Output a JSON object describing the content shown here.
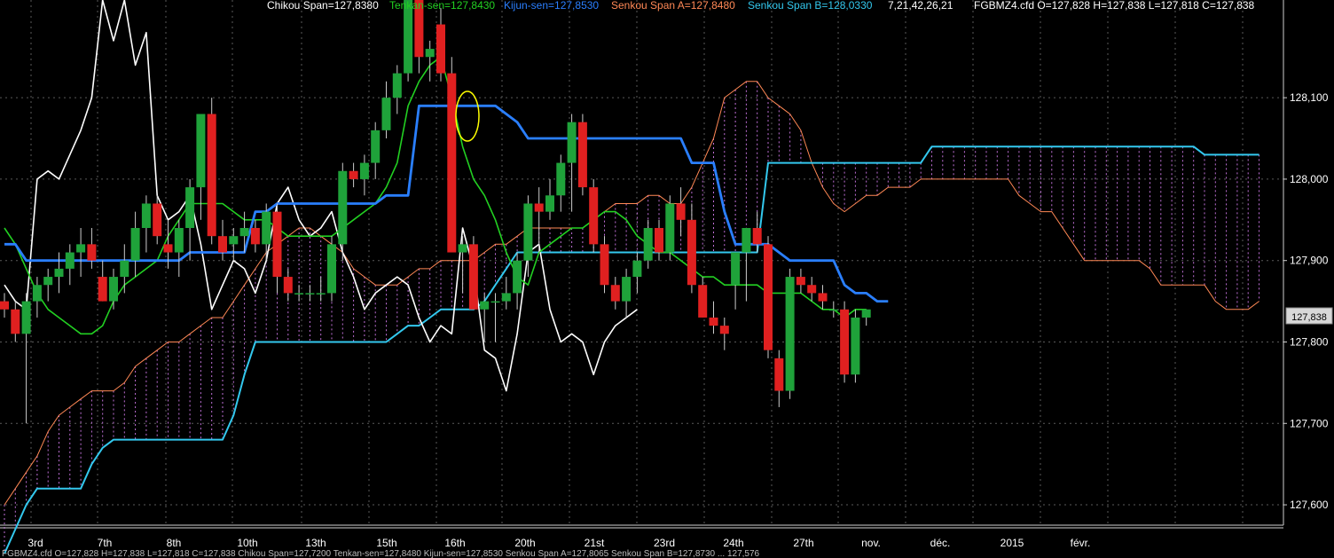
{
  "legend": {
    "chikou": "Chikou Span=127,8380",
    "tenkan": "Tenkan-sen=127,8430",
    "kijun": "Kijun-sen=127,8530",
    "senkou_a": "Senkou Span A=127,8480",
    "senkou_b": "Senkou Span B=128,0330",
    "params": "7,21,42,26,21",
    "ohlc": "FGBMZ4.cfd O=127,828 H=127,838 L=127,818 C=127,838"
  },
  "last_price_label": "127,838",
  "status_bar": "FGBMZ4.cfd O=127,828 H=127,838 L=127,818 C=127,838  Chikou Span=127,7200 Tenkan-sen=127,8480 Kijun-sen=127,8530 Senkou Span A=127,8065 Senkou Span B=127,8730 ... 127,576",
  "colors": {
    "background": "#000000",
    "grid": "#5a5a5a",
    "candle_up": "#1fa23a",
    "candle_down": "#e02020",
    "chikou": "#ffffff",
    "tenkan": "#22d022",
    "kijun": "#2a7fff",
    "senkou_a": "#ff8855",
    "senkou_b": "#33c8ee",
    "cloud": "#c070d8",
    "highlight": "#ffff00"
  },
  "chart_data": {
    "type": "candlestick",
    "instrument": "FGBMZ4.cfd",
    "ylim": [
      127.575,
      128.22
    ],
    "y_ticks": [
      "127,600",
      "127,700",
      "127,800",
      "127,900",
      "128,000",
      "128,100"
    ],
    "y_tick_values": [
      127.6,
      127.7,
      127.8,
      127.9,
      128.0,
      128.1
    ],
    "x_tick_labels": [
      "3rd",
      "7th",
      "8th",
      "10th",
      "13th",
      "15th",
      "16th",
      "20th",
      "21st",
      "23rd",
      "24th",
      "27th",
      "nov.",
      "déc.",
      "2015",
      "févr."
    ],
    "candles": [
      {
        "o": 127.85,
        "h": 127.86,
        "l": 127.83,
        "c": 127.84
      },
      {
        "o": 127.84,
        "h": 127.85,
        "l": 127.8,
        "c": 127.81
      },
      {
        "o": 127.81,
        "h": 127.86,
        "l": 127.7,
        "c": 127.85
      },
      {
        "o": 127.85,
        "h": 127.88,
        "l": 127.83,
        "c": 127.87
      },
      {
        "o": 127.87,
        "h": 127.89,
        "l": 127.85,
        "c": 127.88
      },
      {
        "o": 127.88,
        "h": 127.91,
        "l": 127.86,
        "c": 127.89
      },
      {
        "o": 127.89,
        "h": 127.92,
        "l": 127.87,
        "c": 127.91
      },
      {
        "o": 127.91,
        "h": 127.94,
        "l": 127.88,
        "c": 127.92
      },
      {
        "o": 127.92,
        "h": 127.94,
        "l": 127.89,
        "c": 127.9
      },
      {
        "o": 127.88,
        "h": 127.9,
        "l": 127.85,
        "c": 127.85
      },
      {
        "o": 127.85,
        "h": 127.89,
        "l": 127.84,
        "c": 127.88
      },
      {
        "o": 127.88,
        "h": 127.92,
        "l": 127.86,
        "c": 127.9
      },
      {
        "o": 127.9,
        "h": 127.96,
        "l": 127.88,
        "c": 127.94
      },
      {
        "o": 127.94,
        "h": 127.98,
        "l": 127.91,
        "c": 127.97
      },
      {
        "o": 127.97,
        "h": 127.98,
        "l": 127.92,
        "c": 127.93
      },
      {
        "o": 127.92,
        "h": 127.95,
        "l": 127.89,
        "c": 127.91
      },
      {
        "o": 127.91,
        "h": 127.95,
        "l": 127.88,
        "c": 127.94
      },
      {
        "o": 127.94,
        "h": 128.0,
        "l": 127.9,
        "c": 127.99
      },
      {
        "o": 127.99,
        "h": 128.08,
        "l": 127.95,
        "c": 128.08
      },
      {
        "o": 128.08,
        "h": 128.1,
        "l": 127.92,
        "c": 127.93
      },
      {
        "o": 127.93,
        "h": 127.95,
        "l": 127.9,
        "c": 127.91
      },
      {
        "o": 127.92,
        "h": 127.94,
        "l": 127.9,
        "c": 127.93
      },
      {
        "o": 127.93,
        "h": 127.96,
        "l": 127.91,
        "c": 127.94
      },
      {
        "o": 127.94,
        "h": 127.95,
        "l": 127.91,
        "c": 127.92
      },
      {
        "o": 127.92,
        "h": 127.97,
        "l": 127.9,
        "c": 127.96
      },
      {
        "o": 127.96,
        "h": 127.97,
        "l": 127.86,
        "c": 127.88
      },
      {
        "o": 127.88,
        "h": 127.89,
        "l": 127.85,
        "c": 127.86
      },
      {
        "o": 127.86,
        "h": 127.87,
        "l": 127.85,
        "c": 127.86
      },
      {
        "o": 127.86,
        "h": 127.87,
        "l": 127.85,
        "c": 127.86
      },
      {
        "o": 127.86,
        "h": 127.88,
        "l": 127.85,
        "c": 127.86
      },
      {
        "o": 127.86,
        "h": 127.93,
        "l": 127.85,
        "c": 127.92
      },
      {
        "o": 127.92,
        "h": 128.02,
        "l": 127.9,
        "c": 128.01
      },
      {
        "o": 128.01,
        "h": 128.02,
        "l": 127.99,
        "c": 128.0
      },
      {
        "o": 128.0,
        "h": 128.03,
        "l": 127.98,
        "c": 128.02
      },
      {
        "o": 128.02,
        "h": 128.07,
        "l": 128.0,
        "c": 128.06
      },
      {
        "o": 128.06,
        "h": 128.12,
        "l": 128.05,
        "c": 128.1
      },
      {
        "o": 128.1,
        "h": 128.14,
        "l": 128.08,
        "c": 128.13
      },
      {
        "o": 128.13,
        "h": 128.25,
        "l": 128.12,
        "c": 128.22
      },
      {
        "o": 128.22,
        "h": 128.23,
        "l": 128.13,
        "c": 128.15
      },
      {
        "o": 128.15,
        "h": 128.17,
        "l": 128.12,
        "c": 128.16
      },
      {
        "o": 128.19,
        "h": 128.21,
        "l": 128.12,
        "c": 128.13
      },
      {
        "o": 128.13,
        "h": 128.15,
        "l": 127.91,
        "c": 127.91
      },
      {
        "o": 127.91,
        "h": 127.93,
        "l": 127.86,
        "c": 127.92
      },
      {
        "o": 127.92,
        "h": 127.93,
        "l": 127.84,
        "c": 127.84
      },
      {
        "o": 127.84,
        "h": 127.86,
        "l": 127.8,
        "c": 127.85
      },
      {
        "o": 127.85,
        "h": 127.86,
        "l": 127.8,
        "c": 127.85
      },
      {
        "o": 127.85,
        "h": 127.88,
        "l": 127.84,
        "c": 127.86
      },
      {
        "o": 127.86,
        "h": 127.91,
        "l": 127.84,
        "c": 127.9
      },
      {
        "o": 127.9,
        "h": 127.98,
        "l": 127.88,
        "c": 127.97
      },
      {
        "o": 127.97,
        "h": 127.99,
        "l": 127.91,
        "c": 127.96
      },
      {
        "o": 127.96,
        "h": 128.0,
        "l": 127.95,
        "c": 127.98
      },
      {
        "o": 127.98,
        "h": 128.03,
        "l": 127.96,
        "c": 128.02
      },
      {
        "o": 128.02,
        "h": 128.08,
        "l": 127.96,
        "c": 128.07
      },
      {
        "o": 128.07,
        "h": 128.08,
        "l": 127.98,
        "c": 127.99
      },
      {
        "o": 127.99,
        "h": 128.0,
        "l": 127.91,
        "c": 127.92
      },
      {
        "o": 127.92,
        "h": 127.93,
        "l": 127.86,
        "c": 127.87
      },
      {
        "o": 127.87,
        "h": 127.88,
        "l": 127.84,
        "c": 127.85
      },
      {
        "o": 127.85,
        "h": 127.89,
        "l": 127.83,
        "c": 127.88
      },
      {
        "o": 127.88,
        "h": 127.91,
        "l": 127.86,
        "c": 127.9
      },
      {
        "o": 127.9,
        "h": 127.95,
        "l": 127.89,
        "c": 127.94
      },
      {
        "o": 127.94,
        "h": 127.95,
        "l": 127.9,
        "c": 127.91
      },
      {
        "o": 127.91,
        "h": 127.98,
        "l": 127.9,
        "c": 127.97
      },
      {
        "o": 127.97,
        "h": 127.99,
        "l": 127.93,
        "c": 127.95
      },
      {
        "o": 127.95,
        "h": 127.97,
        "l": 127.86,
        "c": 127.87
      },
      {
        "o": 127.87,
        "h": 127.88,
        "l": 127.83,
        "c": 127.83
      },
      {
        "o": 127.83,
        "h": 127.85,
        "l": 127.81,
        "c": 127.82
      },
      {
        "o": 127.82,
        "h": 127.83,
        "l": 127.79,
        "c": 127.81
      },
      {
        "o": 127.87,
        "h": 127.9,
        "l": 127.84,
        "c": 127.91
      },
      {
        "o": 127.91,
        "h": 127.93,
        "l": 127.85,
        "c": 127.94
      },
      {
        "o": 127.94,
        "h": 127.96,
        "l": 127.91,
        "c": 127.92
      },
      {
        "o": 127.92,
        "h": 127.93,
        "l": 127.78,
        "c": 127.79
      },
      {
        "o": 127.78,
        "h": 127.79,
        "l": 127.72,
        "c": 127.74
      },
      {
        "o": 127.74,
        "h": 127.89,
        "l": 127.73,
        "c": 127.88
      },
      {
        "o": 127.88,
        "h": 127.89,
        "l": 127.86,
        "c": 127.87
      },
      {
        "o": 127.87,
        "h": 127.88,
        "l": 127.85,
        "c": 127.86
      },
      {
        "o": 127.86,
        "h": 127.87,
        "l": 127.84,
        "c": 127.85
      },
      {
        "o": 127.84,
        "h": 127.85,
        "l": 127.83,
        "c": 127.84
      },
      {
        "o": 127.84,
        "h": 127.85,
        "l": 127.75,
        "c": 127.76
      },
      {
        "o": 127.76,
        "h": 127.84,
        "l": 127.75,
        "c": 127.83
      },
      {
        "o": 127.83,
        "h": 127.84,
        "l": 127.82,
        "c": 127.84
      }
    ],
    "tenkan": [
      127.94,
      127.92,
      127.89,
      127.86,
      127.84,
      127.83,
      127.82,
      127.81,
      127.81,
      127.82,
      127.85,
      127.87,
      127.88,
      127.89,
      127.9,
      127.93,
      127.95,
      127.97,
      127.97,
      127.97,
      127.97,
      127.96,
      127.95,
      127.95,
      127.95,
      127.94,
      127.93,
      127.93,
      127.93,
      127.93,
      127.93,
      127.94,
      127.95,
      127.96,
      127.97,
      127.99,
      128.02,
      128.09,
      128.12,
      128.14,
      128.15,
      128.1,
      128.04,
      128.0,
      127.98,
      127.95,
      127.91,
      127.88,
      127.87,
      127.91,
      127.92,
      127.93,
      127.94,
      127.94,
      127.95,
      127.96,
      127.96,
      127.95,
      127.93,
      127.92,
      127.91,
      127.91,
      127.9,
      127.89,
      127.88,
      127.88,
      127.87,
      127.87,
      127.87,
      127.87,
      127.86,
      127.86,
      127.86,
      127.86,
      127.85,
      127.84,
      127.84,
      127.83,
      127.84,
      127.84
    ],
    "kijun": [
      127.92,
      127.92,
      127.9,
      127.9,
      127.9,
      127.9,
      127.9,
      127.9,
      127.9,
      127.9,
      127.9,
      127.9,
      127.9,
      127.9,
      127.9,
      127.9,
      127.9,
      127.91,
      127.91,
      127.91,
      127.91,
      127.91,
      127.91,
      127.96,
      127.96,
      127.97,
      127.97,
      127.97,
      127.97,
      127.97,
      127.97,
      127.97,
      127.97,
      127.97,
      127.97,
      127.98,
      127.98,
      127.98,
      128.09,
      128.09,
      128.09,
      128.09,
      128.09,
      128.09,
      128.09,
      128.09,
      128.08,
      128.07,
      128.05,
      128.05,
      128.05,
      128.05,
      128.05,
      128.05,
      128.05,
      128.05,
      128.05,
      128.05,
      128.05,
      128.05,
      128.05,
      128.05,
      128.05,
      128.02,
      128.02,
      128.02,
      127.96,
      127.92,
      127.92,
      127.92,
      127.92,
      127.91,
      127.9,
      127.9,
      127.9,
      127.9,
      127.9,
      127.87,
      127.86,
      127.86,
      127.85,
      127.85
    ],
    "chikou": [
      127.87,
      127.85,
      127.84,
      128.0,
      128.01,
      128.0,
      128.03,
      128.06,
      128.1,
      128.22,
      128.17,
      128.22,
      128.14,
      128.18,
      127.98,
      127.95,
      127.96,
      127.98,
      127.92,
      127.84,
      127.87,
      127.9,
      127.89,
      127.86,
      127.9,
      127.97,
      127.99,
      127.95,
      127.93,
      127.94,
      127.96,
      127.91,
      127.88,
      127.84,
      127.86,
      127.87,
      127.88,
      127.87,
      127.83,
      127.8,
      127.82,
      127.81,
      127.94,
      127.89,
      127.79,
      127.78,
      127.74,
      127.81,
      127.91,
      127.92,
      127.84,
      127.8,
      127.81,
      127.8,
      127.76,
      127.8,
      127.82,
      127.83,
      127.84
    ],
    "senkou_a": [
      127.6,
      127.62,
      127.64,
      127.66,
      127.69,
      127.71,
      127.72,
      127.73,
      127.74,
      127.74,
      127.74,
      127.75,
      127.77,
      127.78,
      127.79,
      127.8,
      127.8,
      127.81,
      127.82,
      127.83,
      127.83,
      127.85,
      127.87,
      127.89,
      127.91,
      127.92,
      127.93,
      127.94,
      127.94,
      127.93,
      127.92,
      127.91,
      127.89,
      127.88,
      127.87,
      127.87,
      127.87,
      127.88,
      127.89,
      127.89,
      127.9,
      127.9,
      127.9,
      127.9,
      127.91,
      127.92,
      127.92,
      127.93,
      127.94,
      127.94,
      127.94,
      127.94,
      127.94,
      127.94,
      127.95,
      127.96,
      127.97,
      127.97,
      127.97,
      127.98,
      127.98,
      127.97,
      127.97,
      127.99,
      128.02,
      128.05,
      128.1,
      128.11,
      128.12,
      128.12,
      128.1,
      128.09,
      128.08,
      128.06,
      128.02,
      127.99,
      127.97,
      127.96,
      127.97,
      127.98,
      127.98,
      127.99,
      127.99,
      127.99,
      128.0,
      128.0,
      128.0,
      128.0,
      128.0,
      128.0,
      128.0,
      128.0,
      128.0,
      127.98,
      127.97,
      127.96,
      127.96,
      127.94,
      127.92,
      127.9,
      127.9,
      127.9,
      127.9,
      127.9,
      127.9,
      127.89,
      127.87,
      127.87,
      127.87,
      127.87,
      127.87,
      127.85,
      127.84,
      127.84,
      127.84,
      127.85
    ],
    "senkou_b": [
      127.54,
      127.57,
      127.6,
      127.62,
      127.62,
      127.62,
      127.62,
      127.62,
      127.65,
      127.67,
      127.68,
      127.68,
      127.68,
      127.68,
      127.68,
      127.68,
      127.68,
      127.68,
      127.68,
      127.68,
      127.68,
      127.71,
      127.76,
      127.8,
      127.8,
      127.8,
      127.8,
      127.8,
      127.8,
      127.8,
      127.8,
      127.8,
      127.8,
      127.8,
      127.8,
      127.8,
      127.81,
      127.82,
      127.82,
      127.83,
      127.84,
      127.84,
      127.84,
      127.84,
      127.85,
      127.87,
      127.89,
      127.91,
      127.91,
      127.91,
      127.91,
      127.91,
      127.91,
      127.91,
      127.91,
      127.91,
      127.91,
      127.91,
      127.91,
      127.91,
      127.91,
      127.91,
      127.91,
      127.91,
      127.91,
      127.91,
      127.91,
      127.91,
      127.91,
      127.91,
      128.02,
      128.02,
      128.02,
      128.02,
      128.02,
      128.02,
      128.02,
      128.02,
      128.02,
      128.02,
      128.02,
      128.02,
      128.02,
      128.02,
      128.02,
      128.04,
      128.04,
      128.04,
      128.04,
      128.04,
      128.04,
      128.04,
      128.04,
      128.04,
      128.04,
      128.04,
      128.04,
      128.04,
      128.04,
      128.04,
      128.04,
      128.04,
      128.04,
      128.04,
      128.04,
      128.04,
      128.04,
      128.04,
      128.04,
      128.04,
      128.03,
      128.03,
      128.03,
      128.03,
      128.03,
      128.03
    ]
  }
}
